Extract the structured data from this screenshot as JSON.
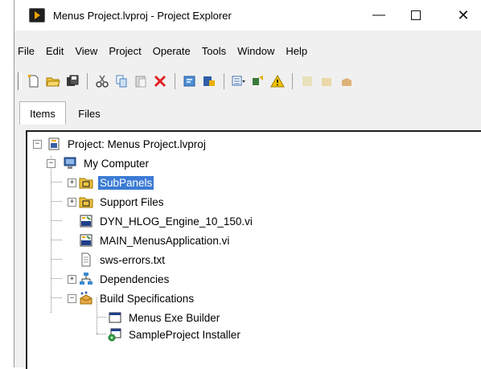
{
  "window": {
    "title": "Menus Project.lvproj - Project Explorer",
    "controls": {
      "minimize": "—",
      "close": "✕"
    }
  },
  "menubar": [
    "File",
    "Edit",
    "View",
    "Project",
    "Operate",
    "Tools",
    "Window",
    "Help"
  ],
  "tabs": {
    "items": "Items",
    "files": "Files"
  },
  "tree": {
    "project": "Project: Menus Project.lvproj",
    "my_computer": "My Computer",
    "subpanels": "SubPanels",
    "support_files": "Support Files",
    "dyn_vi": "DYN_HLOG_Engine_10_150.vi",
    "main_vi": "MAIN_MenusApplication.vi",
    "sws_errors": "sws-errors.txt",
    "dependencies": "Dependencies",
    "build_specs": "Build Specifications",
    "exe_builder": "Menus Exe Builder",
    "installer": "SampleProject Installer"
  },
  "expanders": {
    "plus": "+",
    "minus": "−"
  },
  "colors": {
    "selection": "#3b7bd4",
    "folder": "#f2c53d",
    "accent": "#f0a000"
  }
}
